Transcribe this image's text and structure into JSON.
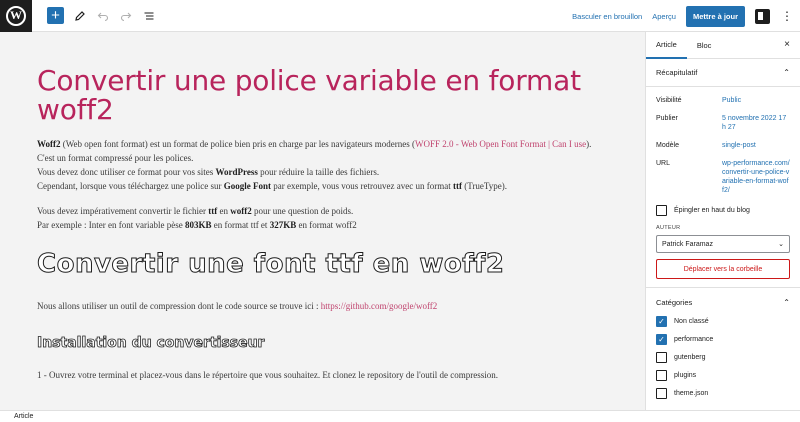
{
  "toolbar": {
    "logo": "W",
    "add_label": "+",
    "switch_draft": "Basculer en brouillon",
    "preview": "Aperçu",
    "update": "Mettre à jour",
    "more": "⋮"
  },
  "post": {
    "title": "Convertir une police variable en format woff2",
    "p1_b1": "Woff2",
    "p1_t1": " (Web open font format) est un format de police bien pris en charge par les navigateurs modernes (",
    "p1_link": "WOFF 2.0 - Web Open Font Format | Can I use",
    "p1_t2": "). C'est un format compressé pour les polices.",
    "p2_t1": "Vous devez donc utiliser ce format pour vos sites ",
    "p2_b1": "WordPress",
    "p2_t2": " pour réduire la taille des fichiers.",
    "p3_t1": "Cependant, lorsque vous téléchargez une police sur ",
    "p3_b1": "Google Font",
    "p3_t2": " par exemple, vous vous retrouvez avec un format ",
    "p3_b2": "ttf",
    "p3_t3": " (TrueType).",
    "p4_t1": "Vous devez impérativement convertir le fichier ",
    "p4_b1": "ttf",
    "p4_t2": " en ",
    "p4_b2": "woff2",
    "p4_t3": " pour une question de poids.",
    "p5_t1": "Par exemple : Inter en font variable pèse ",
    "p5_b1": "803KB",
    "p5_t2": " en format ttf et ",
    "p5_b2": "327KB",
    "p5_t3": " en format woff2",
    "h2": "Convertir une font ttf en woff2",
    "p6_t1": "Nous allons utiliser un outil de compression dont le code source se trouve ici : ",
    "p6_link": "https://github.com/google/woff2",
    "h3": "Installation du convertisseur",
    "p7": "1 - Ouvrez votre terminal et placez-vous dans le répertoire que vous souhaitez. Et clonez le repository de l'outil de compression."
  },
  "sidebar": {
    "tab_article": "Article",
    "tab_block": "Bloc",
    "close": "×",
    "summary": {
      "title": "Récapitulatif",
      "visibility_label": "Visibilité",
      "visibility_value": "Public",
      "publish_label": "Publier",
      "publish_value": "5 novembre 2022 17 h 27",
      "template_label": "Modèle",
      "template_value": "single-post",
      "url_label": "URL",
      "url_value": "wp-performance.com/convertir-une-police-variable-en-format-woff2/",
      "pin_label": "Épingler en haut du blog",
      "author_caption": "AUTEUR",
      "author_value": "Patrick Faramaz",
      "trash": "Déplacer vers la corbeille"
    },
    "categories": {
      "title": "Catégories",
      "items": [
        {
          "label": "Non classé",
          "checked": true
        },
        {
          "label": "performance",
          "checked": true
        },
        {
          "label": "gutenberg",
          "checked": false
        },
        {
          "label": "plugins",
          "checked": false
        },
        {
          "label": "theme.json",
          "checked": false
        }
      ]
    }
  },
  "footer": {
    "breadcrumb": "Article"
  },
  "colors": {
    "accent": "#2271b1",
    "title": "#b8245c",
    "link": "#c0436e",
    "danger": "#cc1818"
  }
}
